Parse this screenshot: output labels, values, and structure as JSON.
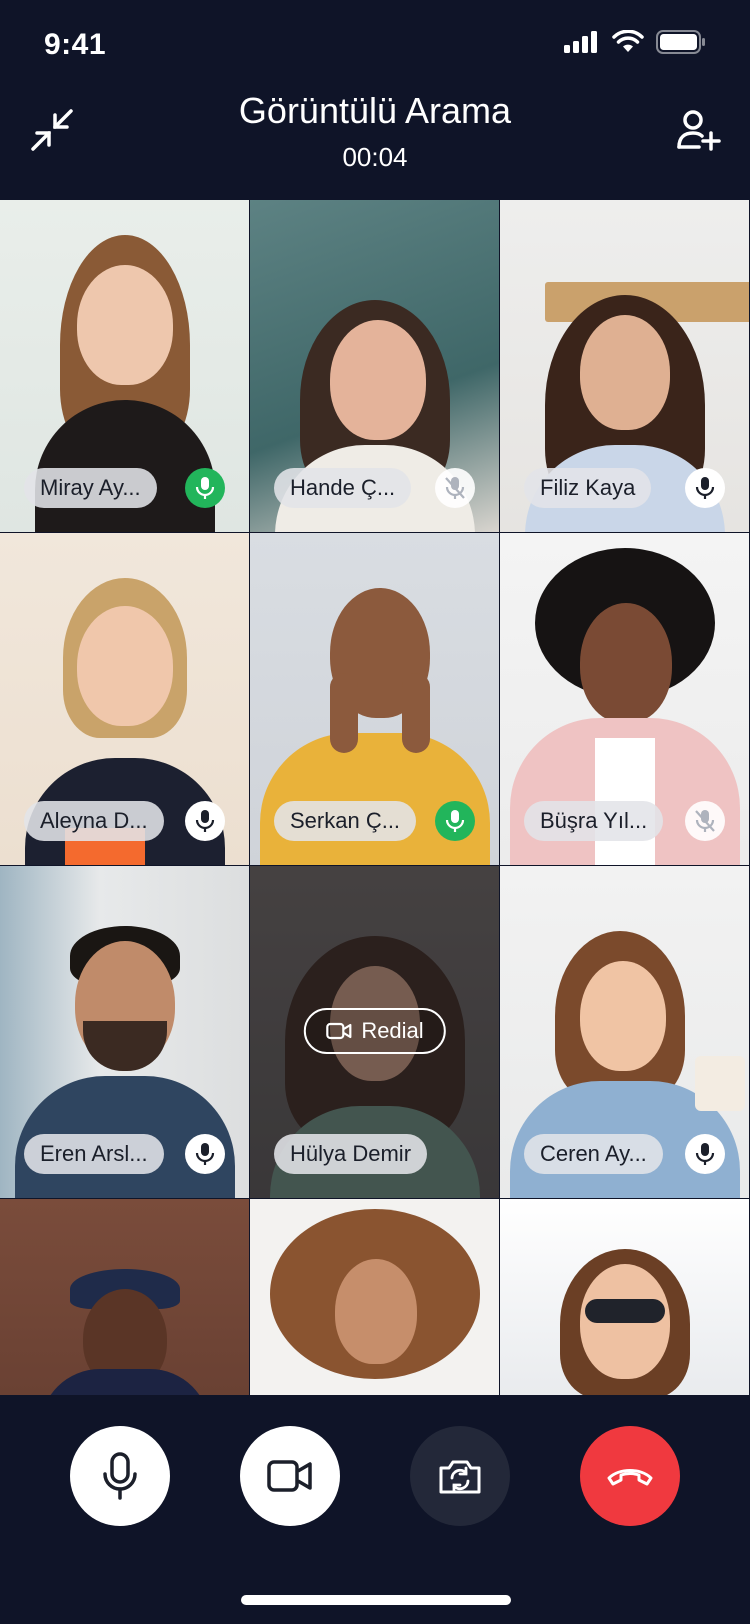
{
  "status_bar": {
    "time": "9:41",
    "icons": [
      "signal-icon",
      "wifi-icon",
      "battery-icon"
    ]
  },
  "header": {
    "title": "Görüntülü Arama",
    "timer": "00:04",
    "minimize_icon": "minimize-arrows-icon",
    "add_person_icon": "add-person-icon"
  },
  "participants": [
    {
      "name": "Miray Ay...",
      "mic": "on"
    },
    {
      "name": "Hande Ç...",
      "mic": "muted"
    },
    {
      "name": "Filiz Kaya",
      "mic": "neutral"
    },
    {
      "name": "Aleyna D...",
      "mic": "neutral"
    },
    {
      "name": "Serkan Ç...",
      "mic": "on"
    },
    {
      "name": "Büşra Yıl...",
      "mic": "muted"
    },
    {
      "name": "Eren Arsl...",
      "mic": "neutral"
    },
    {
      "name": "Hülya Demir",
      "mic": "none",
      "redial_label": "Redial"
    },
    {
      "name": "Ceren Ay...",
      "mic": "neutral"
    },
    {
      "name": "",
      "mic": "none"
    },
    {
      "name": "",
      "mic": "none"
    },
    {
      "name": "",
      "mic": "none"
    }
  ],
  "controls": {
    "mic": "mic-icon",
    "camera": "camera-icon",
    "flip": "flip-camera-icon",
    "end": "end-call-icon"
  },
  "colors": {
    "background": "#0f1428",
    "mic_on": "#22b55b",
    "end_call": "#f0393f",
    "dark_button": "#232839"
  }
}
